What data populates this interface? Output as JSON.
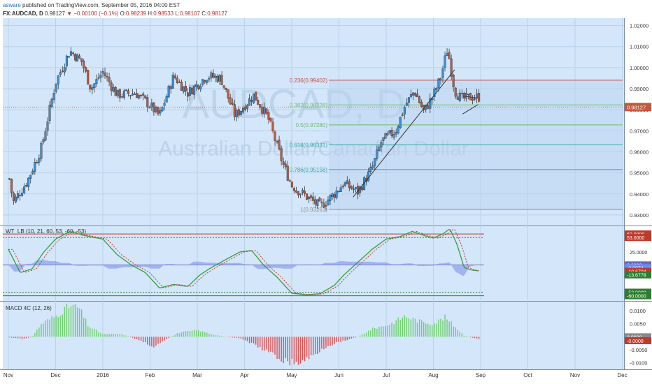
{
  "header": {
    "author": "asware",
    "published": "published on TradingView.com, September 05, 2016 04:00 EST",
    "symbol": "FX:AUDCAD, D",
    "last": "0.98127",
    "change": "▼ −0.00100 (−0.1%)",
    "o_label": "O:",
    "o_val": "0.98239",
    "h_label": "H:",
    "h_val": "0.98533",
    "l_label": "L:",
    "l_val": "0.98107",
    "c_label": "C:",
    "c_val": "0.98127"
  },
  "watermark": {
    "ticker": "AUDCAD, D",
    "name": "Australian Dollar/Canadian Dollar"
  },
  "colors": {
    "panel_bg": "#d3e6fa",
    "bull": "#3a8fd6",
    "bear": "#c1593b",
    "grid": "#b9d2ec",
    "sep": "#7a8a9a",
    "fib_red": "#c0504d",
    "fib_green": "#6abf6a",
    "fib_teal": "#38a6a0",
    "fib_gray": "#8d8d8d",
    "wt_green": "#3a9c3a",
    "wt_red": "#c0392b",
    "hist_pos": "#6fd06f",
    "hist_neg": "#e05050"
  },
  "chart_data": [
    {
      "type": "candlestick",
      "title": "FX:AUDCAD, D",
      "xlabels": [
        "Nov",
        "Dec",
        "2016",
        "Feb",
        "Mar",
        "Apr",
        "May",
        "Jun",
        "Jul",
        "Aug",
        "Sep",
        "Oct",
        "Nov",
        "Dec"
      ],
      "ylim": [
        0.925,
        1.0235
      ],
      "yticks": [
        "1.02000",
        "1.01000",
        "1.00000",
        "0.99000",
        "0.98000",
        "0.97000",
        "0.96000",
        "0.95000",
        "0.94000",
        "0.93000"
      ],
      "ytick_values": [
        1.02,
        1.01,
        1.0,
        0.99,
        0.98,
        0.97,
        0.96,
        0.95,
        0.94,
        0.93
      ],
      "price_anchors": [
        {
          "m": 0.0,
          "p": 0.95
        },
        {
          "m": 0.1,
          "p": 0.936
        },
        {
          "m": 0.4,
          "p": 0.946
        },
        {
          "m": 0.7,
          "p": 0.962
        },
        {
          "m": 1.0,
          "p": 0.993
        },
        {
          "m": 1.3,
          "p": 1.008
        },
        {
          "m": 1.55,
          "p": 1.003
        },
        {
          "m": 1.75,
          "p": 0.99
        },
        {
          "m": 2.0,
          "p": 0.998
        },
        {
          "m": 2.3,
          "p": 0.987
        },
        {
          "m": 2.7,
          "p": 0.988
        },
        {
          "m": 3.0,
          "p": 0.982
        },
        {
          "m": 3.2,
          "p": 0.977
        },
        {
          "m": 3.5,
          "p": 0.996
        },
        {
          "m": 3.8,
          "p": 0.988
        },
        {
          "m": 4.2,
          "p": 0.996
        },
        {
          "m": 4.5,
          "p": 0.995
        },
        {
          "m": 4.8,
          "p": 0.977
        },
        {
          "m": 5.2,
          "p": 0.987
        },
        {
          "m": 5.5,
          "p": 0.976
        },
        {
          "m": 5.8,
          "p": 0.955
        },
        {
          "m": 6.0,
          "p": 0.944
        },
        {
          "m": 6.3,
          "p": 0.939
        },
        {
          "m": 6.6,
          "p": 0.934
        },
        {
          "m": 6.9,
          "p": 0.94
        },
        {
          "m": 7.1,
          "p": 0.945
        },
        {
          "m": 7.4,
          "p": 0.941
        },
        {
          "m": 7.7,
          "p": 0.952
        },
        {
          "m": 7.9,
          "p": 0.965
        },
        {
          "m": 8.2,
          "p": 0.97
        },
        {
          "m": 8.4,
          "p": 0.982
        },
        {
          "m": 8.6,
          "p": 0.989
        },
        {
          "m": 8.8,
          "p": 0.979
        },
        {
          "m": 9.0,
          "p": 0.987
        },
        {
          "m": 9.15,
          "p": 0.995
        },
        {
          "m": 9.3,
          "p": 1.009
        },
        {
          "m": 9.45,
          "p": 0.989
        },
        {
          "m": 9.6,
          "p": 0.985
        },
        {
          "m": 9.8,
          "p": 0.986
        },
        {
          "m": 9.98,
          "p": 0.986
        }
      ],
      "last_price": "0.98127",
      "last_price_value": 0.98127,
      "fib_levels": [
        {
          "label": "0.236(0.99402)",
          "value": 0.99402,
          "color": "fib_red"
        },
        {
          "label": "0.382(0.98228)",
          "value": 0.98228,
          "color": "fib_green"
        },
        {
          "label": "0.5(0.97280)",
          "value": 0.9728,
          "color": "fib_green"
        },
        {
          "label": "0.618(0.96331)",
          "value": 0.96331,
          "color": "fib_teal"
        },
        {
          "label": "0.786(0.95158)",
          "value": 0.95158,
          "color": "fib_teal"
        },
        {
          "label": "1(0.93261)",
          "value": 0.93261,
          "color": "fib_gray"
        }
      ],
      "fib_range": [
        "2016-05-25",
        "2016-09-30"
      ]
    },
    {
      "type": "line",
      "title": "WT_LB (10, 21, 60, 53, -60, -53)",
      "ylim": [
        -70,
        75
      ],
      "levels": [
        60,
        53,
        0,
        -53,
        -60
      ],
      "right_labels": [
        {
          "text": "60.0000",
          "value": 60,
          "color": "#c0392b"
        },
        {
          "text": "53.0000",
          "value": 53,
          "color": "#c0392b"
        },
        {
          "text": "25.0000",
          "value": 25,
          "color": "none"
        },
        {
          "text": "0.0000",
          "value": 0,
          "color": "#6b6bb0"
        },
        {
          "text": "-3.0074",
          "value": -5.5,
          "color": "#6a8aff"
        },
        {
          "text": "-10.6704",
          "value": -12.5,
          "color": "#c0392b"
        },
        {
          "text": "-13.6778",
          "value": -19.5,
          "color": "#2e7d32"
        },
        {
          "text": "-53.0000",
          "value": -53,
          "color": "#2e7d32"
        },
        {
          "text": "-60.0000",
          "value": -60,
          "color": "#2e7d32"
        }
      ],
      "series_anchors": [
        {
          "m": 0.0,
          "v": 30
        },
        {
          "m": 0.25,
          "v": -15
        },
        {
          "m": 0.5,
          "v": -8
        },
        {
          "m": 0.75,
          "v": 25
        },
        {
          "m": 1.0,
          "v": 50
        },
        {
          "m": 1.3,
          "v": 65
        },
        {
          "m": 1.6,
          "v": 57
        },
        {
          "m": 2.0,
          "v": 50
        },
        {
          "m": 2.3,
          "v": 20
        },
        {
          "m": 2.6,
          "v": 0
        },
        {
          "m": 2.9,
          "v": -15
        },
        {
          "m": 3.2,
          "v": -45
        },
        {
          "m": 3.5,
          "v": -38
        },
        {
          "m": 3.8,
          "v": -42
        },
        {
          "m": 4.05,
          "v": -20
        },
        {
          "m": 4.3,
          "v": -5
        },
        {
          "m": 4.6,
          "v": 10
        },
        {
          "m": 4.9,
          "v": 25
        },
        {
          "m": 5.15,
          "v": 28
        },
        {
          "m": 5.4,
          "v": 0
        },
        {
          "m": 5.7,
          "v": -25
        },
        {
          "m": 6.0,
          "v": -55
        },
        {
          "m": 6.3,
          "v": -58
        },
        {
          "m": 6.6,
          "v": -56
        },
        {
          "m": 6.9,
          "v": -40
        },
        {
          "m": 7.1,
          "v": -20
        },
        {
          "m": 7.4,
          "v": 5
        },
        {
          "m": 7.7,
          "v": 30
        },
        {
          "m": 8.0,
          "v": 50
        },
        {
          "m": 8.3,
          "v": 55
        },
        {
          "m": 8.55,
          "v": 65
        },
        {
          "m": 8.8,
          "v": 57
        },
        {
          "m": 9.0,
          "v": 52
        },
        {
          "m": 9.2,
          "v": 60
        },
        {
          "m": 9.35,
          "v": 70
        },
        {
          "m": 9.5,
          "v": 40
        },
        {
          "m": 9.65,
          "v": -5
        },
        {
          "m": 9.8,
          "v": -10
        },
        {
          "m": 9.98,
          "v": -12
        }
      ]
    },
    {
      "type": "bar",
      "title": "MACD 4C (12, 26)",
      "ylim": [
        -0.0125,
        0.0135
      ],
      "yticks": [
        "0.0100",
        "0.0050",
        "0.0000",
        "-0.0050",
        "-0.0100"
      ],
      "ytick_values": [
        0.01,
        0.005,
        0.0,
        -0.005,
        -0.01
      ],
      "right_labels": [
        {
          "text": "0.0000",
          "value": 0.0,
          "color": "#8a8a8a"
        },
        {
          "text": "-0.0008",
          "value": -0.0015,
          "color": "#c0392b"
        }
      ],
      "hist_anchors": [
        {
          "m": 0.0,
          "v": -0.0002
        },
        {
          "m": 0.3,
          "v": -0.0008
        },
        {
          "m": 0.5,
          "v": 0.0
        },
        {
          "m": 0.7,
          "v": 0.005
        },
        {
          "m": 1.0,
          "v": 0.008
        },
        {
          "m": 1.3,
          "v": 0.012
        },
        {
          "m": 1.5,
          "v": 0.011
        },
        {
          "m": 1.7,
          "v": 0.004
        },
        {
          "m": 2.0,
          "v": 0.001
        },
        {
          "m": 2.4,
          "v": 0.001
        },
        {
          "m": 2.8,
          "v": -0.0015
        },
        {
          "m": 3.1,
          "v": -0.004
        },
        {
          "m": 3.3,
          "v": -0.0015
        },
        {
          "m": 3.6,
          "v": 0.0015
        },
        {
          "m": 4.0,
          "v": 0.0025
        },
        {
          "m": 4.3,
          "v": 0.001
        },
        {
          "m": 4.6,
          "v": 0.0
        },
        {
          "m": 4.9,
          "v": -0.0005
        },
        {
          "m": 5.2,
          "v": -0.003
        },
        {
          "m": 5.5,
          "v": -0.006
        },
        {
          "m": 5.8,
          "v": -0.009
        },
        {
          "m": 6.1,
          "v": -0.0105
        },
        {
          "m": 6.4,
          "v": -0.008
        },
        {
          "m": 6.7,
          "v": -0.004
        },
        {
          "m": 7.0,
          "v": -0.002
        },
        {
          "m": 7.4,
          "v": 0.0
        },
        {
          "m": 7.7,
          "v": 0.003
        },
        {
          "m": 8.1,
          "v": 0.005
        },
        {
          "m": 8.4,
          "v": 0.008
        },
        {
          "m": 8.7,
          "v": 0.006
        },
        {
          "m": 9.0,
          "v": 0.005
        },
        {
          "m": 9.25,
          "v": 0.0075
        },
        {
          "m": 9.45,
          "v": 0.004
        },
        {
          "m": 9.65,
          "v": 0.0005
        },
        {
          "m": 9.85,
          "v": -0.0005
        },
        {
          "m": 9.98,
          "v": -0.0008
        }
      ]
    }
  ]
}
